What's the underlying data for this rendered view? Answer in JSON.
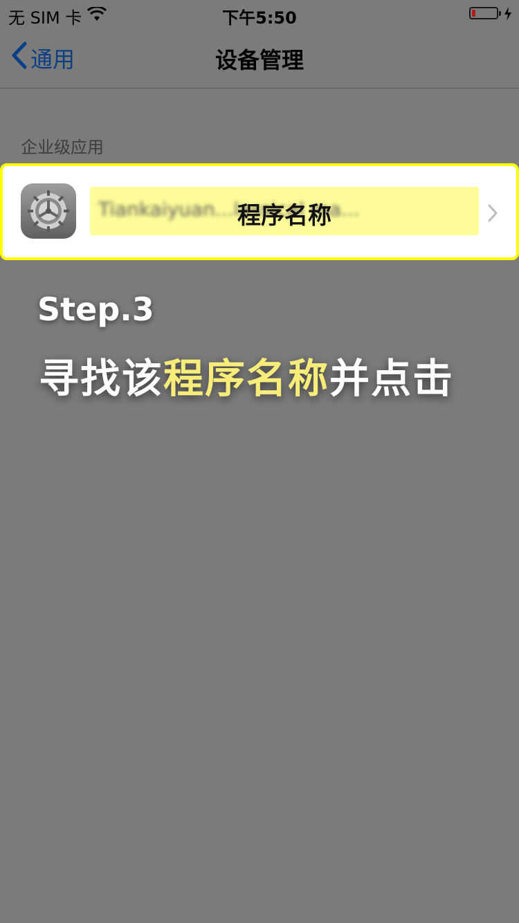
{
  "status_bar": {
    "carrier": "无 SIM 卡",
    "time": "下午5:50",
    "icons": [
      "wifi-icon",
      "battery-icon",
      "charging-bolt-icon"
    ]
  },
  "nav": {
    "back_label": "通用",
    "title": "设备管理"
  },
  "section": {
    "header": "企业级应用"
  },
  "app_row": {
    "blurred_name": "Tiankaiyuan...lassical ma...",
    "overlay_label": "程序名称",
    "highlight_color": "#ffff00",
    "icon": "settings-gear-icon"
  },
  "instruction": {
    "step": "Step.3",
    "prefix": "寻找该",
    "highlight": "程序名称",
    "suffix": "并点击",
    "highlight_color": "#f8ec7a"
  }
}
